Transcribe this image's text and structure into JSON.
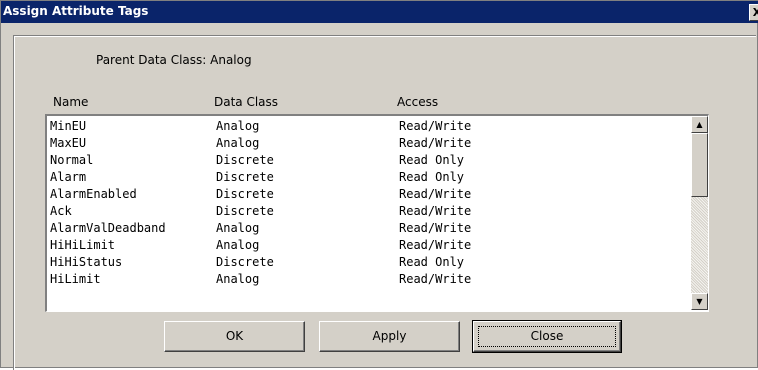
{
  "window": {
    "title": "Assign Attribute Tags",
    "close_glyph": "X"
  },
  "parent_class": "Parent Data Class: Analog",
  "columns": [
    "Name",
    "Data Class",
    "Access"
  ],
  "rows": [
    [
      "MinEU",
      "Analog",
      "Read/Write"
    ],
    [
      "MaxEU",
      "Analog",
      "Read/Write"
    ],
    [
      "Normal",
      "Discrete",
      "Read Only"
    ],
    [
      "Alarm",
      "Discrete",
      "Read Only"
    ],
    [
      "AlarmEnabled",
      "Discrete",
      "Read/Write"
    ],
    [
      "Ack",
      "Discrete",
      "Read/Write"
    ],
    [
      "AlarmValDeadband",
      "Analog",
      "Read/Write"
    ],
    [
      "HiHiLimit",
      "Analog",
      "Read/Write"
    ],
    [
      "HiHiStatus",
      "Discrete",
      "Read Only"
    ],
    [
      "HiLimit",
      "Analog",
      "Read/Write"
    ]
  ],
  "scrollbar": {
    "up_icon": "scroll-up-arrow",
    "down_icon": "scroll-down-arrow",
    "up_glyph": "▲",
    "down_glyph": "▼"
  },
  "buttons": {
    "ok": "OK",
    "apply": "Apply",
    "close": "Close"
  }
}
